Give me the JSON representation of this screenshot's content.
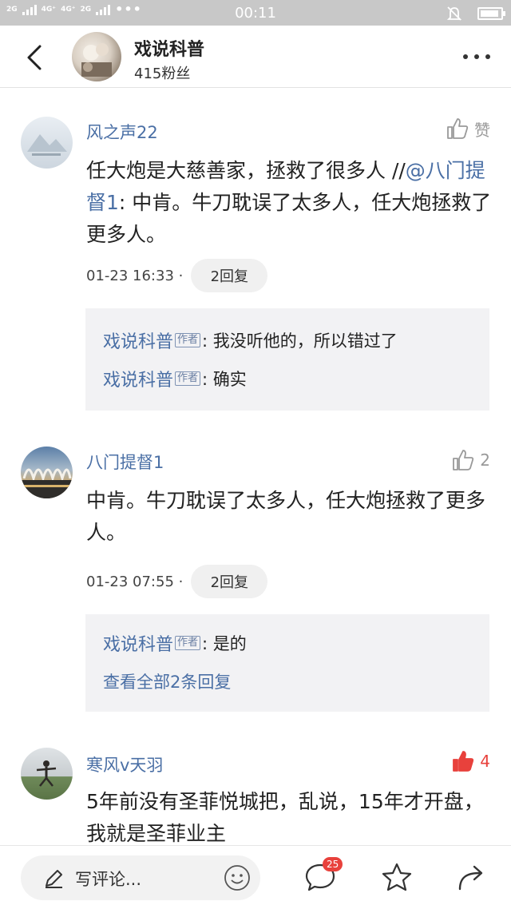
{
  "status_bar": {
    "network_1": "2G",
    "network_2": "4G⁺",
    "network_3": "4G⁺",
    "network_4": "2G",
    "dots": "•••",
    "time": "00:11",
    "battery_level": 0.9
  },
  "header": {
    "title": "戏说科普",
    "followers": "415粉丝",
    "back_icon": "chevron-left-icon",
    "more_icon": "more-dots-icon"
  },
  "comments": [
    {
      "name": "风之声22",
      "like_label": "赞",
      "liked": false,
      "text_plain": "任大炮是大慈善家，拯救了很多人 //",
      "mention": "@八门提督1",
      "text_after": ": 中肯。牛刀耽误了太多人，任大炮拯救了更多人。",
      "time": "01-23 16:33 ·",
      "reply_label": "2回复",
      "replies": [
        {
          "name": "戏说科普",
          "tag": "作者",
          "text": ": 我没听他的，所以错过了"
        },
        {
          "name": "戏说科普",
          "tag": "作者",
          "text": ": 确实"
        }
      ]
    },
    {
      "name": "八门提督1",
      "like_label": "2",
      "liked": false,
      "text": "中肯。牛刀耽误了太多人，任大炮拯救了更多人。",
      "time": "01-23 07:55 ·",
      "reply_label": "2回复",
      "replies": [
        {
          "name": "戏说科普",
          "tag": "作者",
          "text": ": 是的"
        }
      ],
      "see_all": "查看全部2条回复"
    },
    {
      "name": "寒风v天羽",
      "like_label": "4",
      "liked": true,
      "text": "5年前没有圣菲悦城把，乱说，15年才开盘，我就是圣菲业主"
    }
  ],
  "bottom_bar": {
    "write_placeholder": "写评论...",
    "comment_count": "25"
  },
  "colors": {
    "link_blue": "#4a6fa5",
    "like_red": "#e8413c",
    "reply_bg": "#f2f2f4"
  }
}
